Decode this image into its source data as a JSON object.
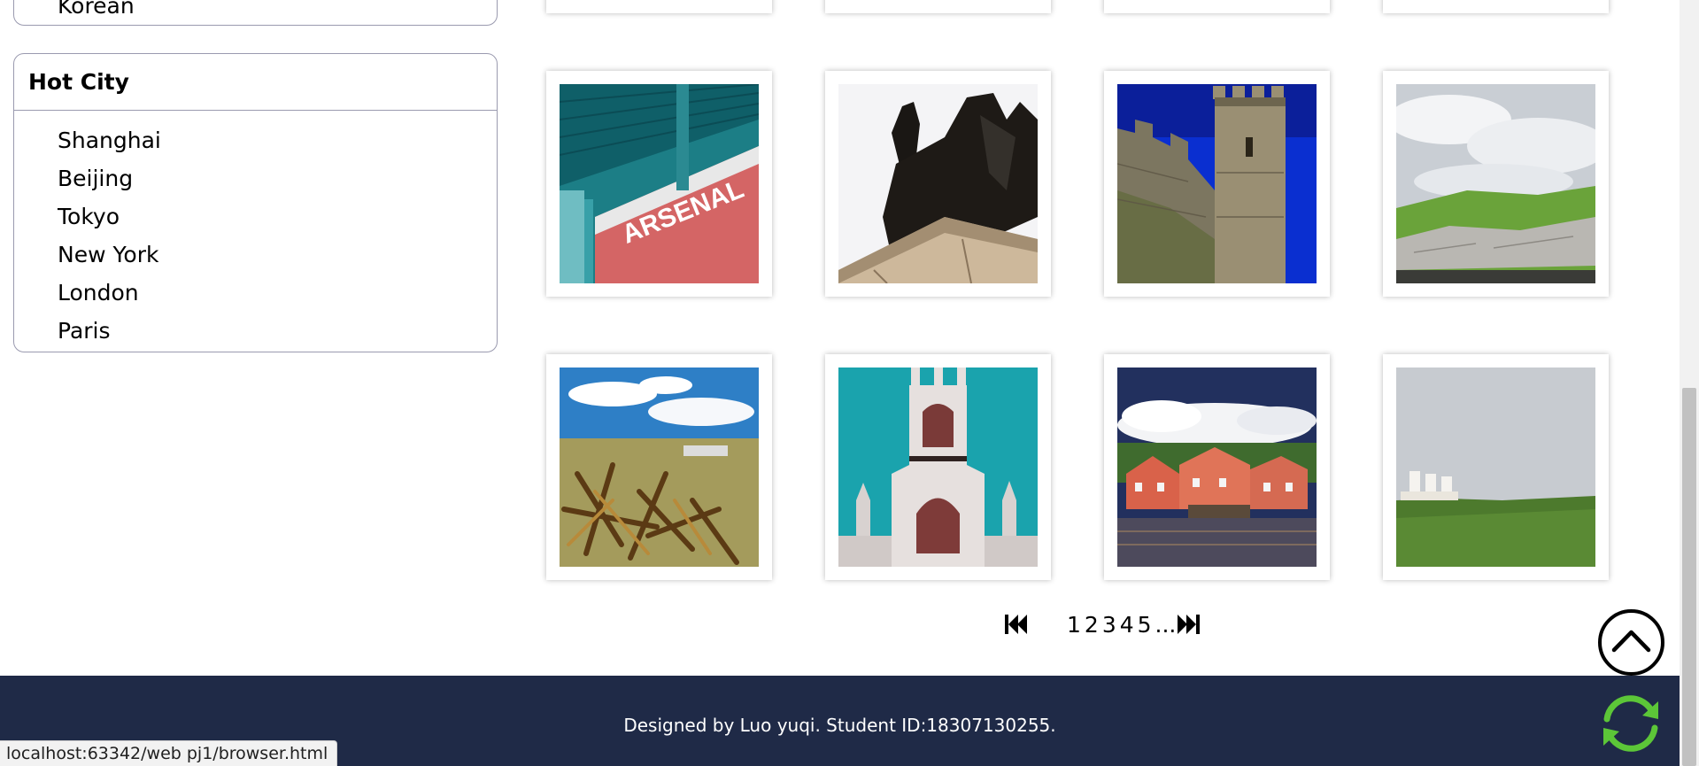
{
  "sidebar": {
    "prev_panel_item": "Korean",
    "hot_city": {
      "title": "Hot City",
      "items": [
        "Shanghai",
        "Beijing",
        "Tokyo",
        "New York",
        "London",
        "Paris"
      ]
    }
  },
  "pagination": {
    "first_icon": "first-page-icon",
    "pages": [
      "1",
      "2",
      "3",
      "4",
      "5"
    ],
    "ellipsis": "...",
    "last_icon": "last-page-icon"
  },
  "footer": {
    "text": "Designed by Luo yuqi. Student ID:18307130255."
  },
  "status_bar": {
    "url": "localhost:63342/web pj1/browser.html"
  },
  "icons": {
    "back_to_top": "chevron-up-icon",
    "refresh": "refresh-icon"
  },
  "colors": {
    "footer_bg": "#1f2a47",
    "refresh_green": "#5cc638",
    "panel_border": "#9a9aaf"
  }
}
